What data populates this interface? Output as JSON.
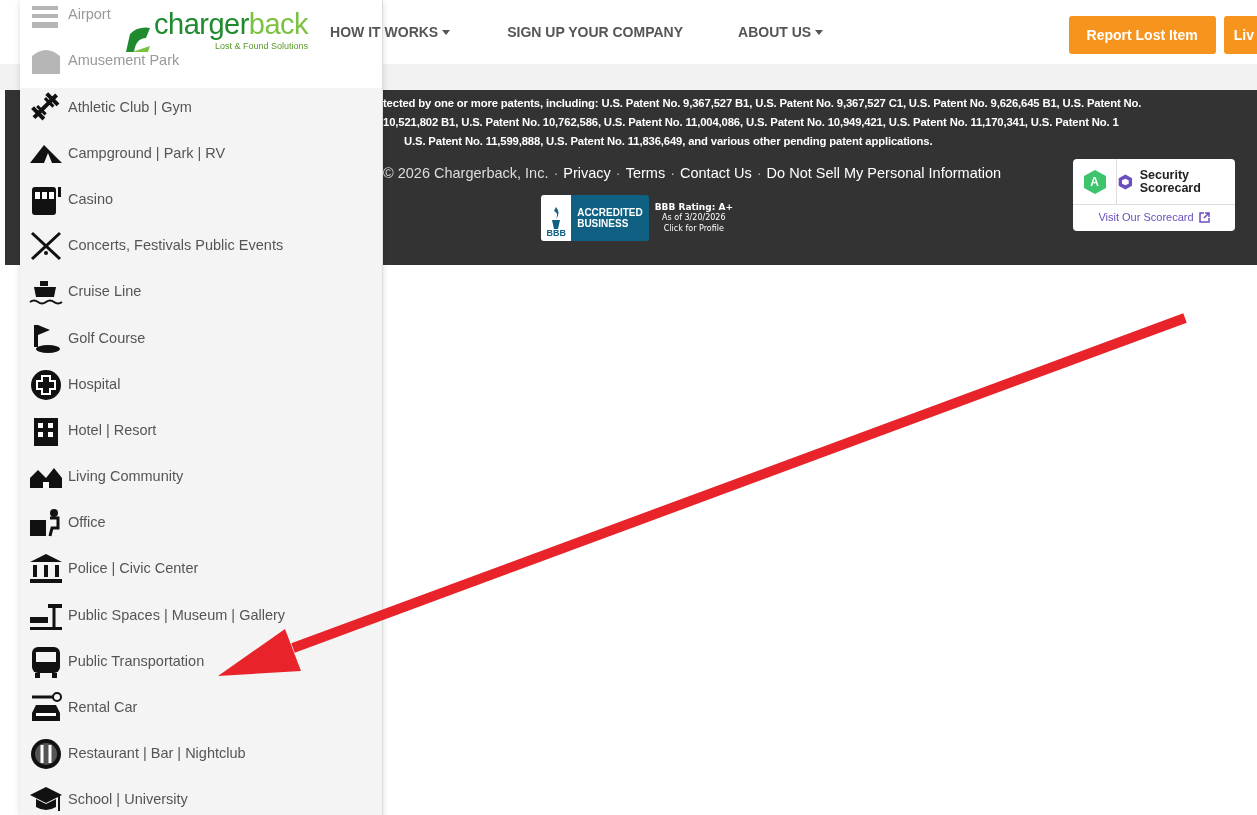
{
  "header": {
    "logo": {
      "part_1": "charger",
      "part_2": "back",
      "tagline": "Lost & Found Solutions"
    },
    "nav": [
      {
        "label": "HOW IT WORKS",
        "dropdown": true
      },
      {
        "label": "SIGN UP YOUR COMPANY",
        "dropdown": false
      },
      {
        "label": "ABOUT US",
        "dropdown": true
      }
    ],
    "buttons": [
      "Report Lost Item",
      "Liv"
    ]
  },
  "footer": {
    "patent_lines": [
      "tected by one or more patents, including: U.S. Patent No. 9,367,527 B1, U.S. Patent No. 9,367,527 C1, U.S. Patent No. 9,626,645 B1, U.S. Patent No.",
      "10,521,802 B1, U.S. Patent No. 10,762,586, U.S. Patent No. 11,004,086, U.S. Patent No. 10,949,421, U.S. Patent No. 11,170,341, U.S. Patent No. 1",
      "U.S. Patent No. 11,599,888, U.S. Patent No. 11,836,649, and various other pending patent applications."
    ],
    "separator": "·",
    "legal": [
      {
        "text": "© 2026 Chargerback, Inc.",
        "kind": "text"
      },
      {
        "text": "Privacy",
        "kind": "link"
      },
      {
        "text": "Terms",
        "kind": "link"
      },
      {
        "text": "Contact Us",
        "kind": "link"
      },
      {
        "text": "Do Not Sell My Personal Information",
        "kind": "link"
      }
    ],
    "bbb": {
      "logo_text": "BBB",
      "badge_text": "ACCREDITED BUSINESS",
      "rating": "BBB Rating: A+",
      "date": "As of 3/20/2026",
      "link": "Click for Profile"
    },
    "scorecard": {
      "grade": "A",
      "title": "Security Scorecard",
      "link": "Visit Our Scorecard"
    }
  },
  "dropdown_menu": {
    "items": [
      {
        "label": "Airport",
        "faded": true
      },
      {
        "label": "Amusement Park",
        "faded": true
      },
      {
        "label": "Athletic Club | Gym",
        "faded": false
      },
      {
        "label": "Campground | Park | RV",
        "faded": false
      },
      {
        "label": "Casino",
        "faded": false
      },
      {
        "label": "Concerts, Festivals Public Events",
        "faded": false
      },
      {
        "label": "Cruise Line",
        "faded": false
      },
      {
        "label": "Golf Course",
        "faded": false
      },
      {
        "label": "Hospital",
        "faded": false
      },
      {
        "label": "Hotel | Resort",
        "faded": false
      },
      {
        "label": "Living Community",
        "faded": false
      },
      {
        "label": "Office",
        "faded": false
      },
      {
        "label": "Police | Civic Center",
        "faded": false
      },
      {
        "label": "Public Spaces | Museum | Gallery",
        "faded": false
      },
      {
        "label": "Public Transportation",
        "faded": false
      },
      {
        "label": "Rental Car",
        "faded": false
      },
      {
        "label": "Restaurant | Bar | Nightclub",
        "faded": false
      },
      {
        "label": "School | University",
        "faded": false
      }
    ]
  }
}
